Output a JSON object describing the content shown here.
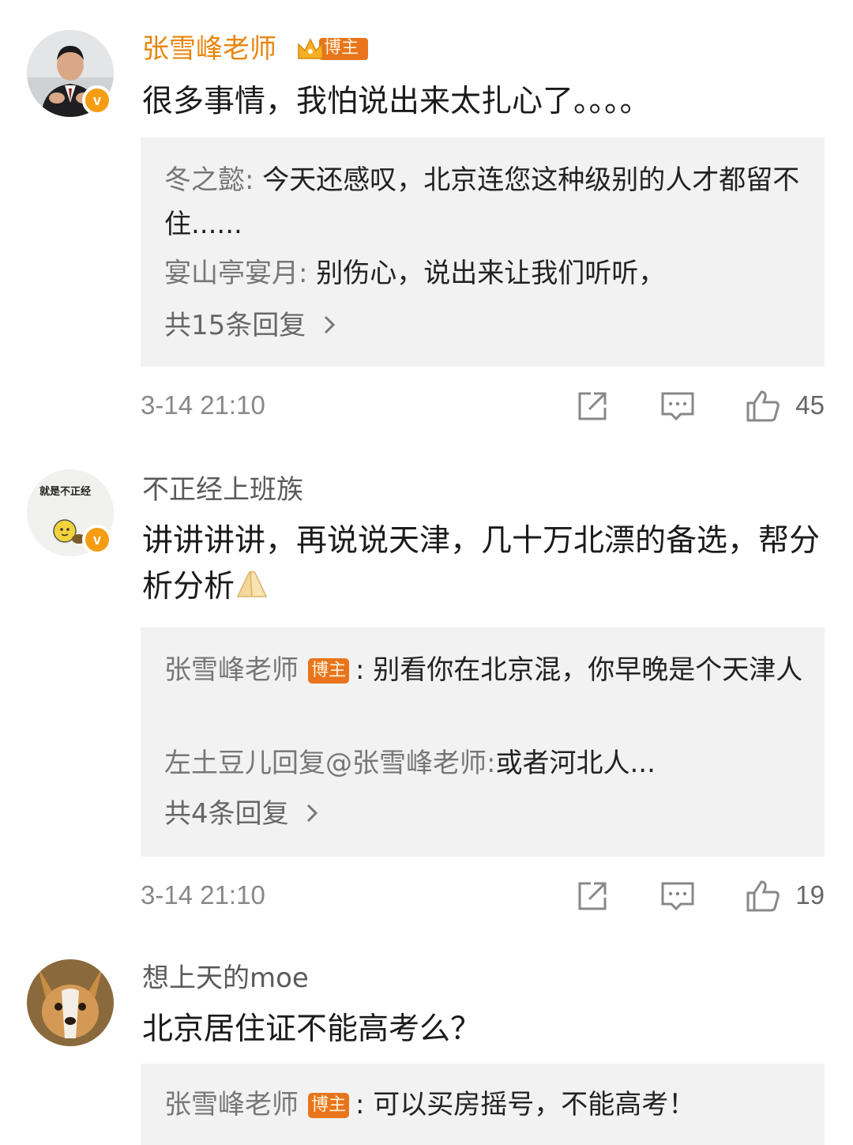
{
  "comments": [
    {
      "username": "张雪峰老师",
      "badge": "博主",
      "text": "很多事情，我怕说出来太扎心了。。。。",
      "replies": [
        {
          "name": "冬之懿",
          "sep": ": ",
          "text": "今天还感叹，北京连您这种级别的人才都留不住......"
        },
        {
          "name": "宴山亭宴月",
          "sep": ": ",
          "text": "别伤心，说出来让我们听听，"
        }
      ],
      "more_replies": "共15条回复",
      "timestamp": "3-14 21:10",
      "likes": "45"
    },
    {
      "username": "不正经上班族",
      "avatar_text": "就是不正经",
      "text": "讲讲讲讲，再说说天津，几十万北漂的备选，帮分析分析",
      "replies": [
        {
          "name": "张雪峰老师",
          "badge": "博主",
          "sep": ": ",
          "text": "别看你在北京混，你早晚是个天津人"
        },
        {
          "name": "左土豆儿回复@张雪峰老师",
          "sep": ":",
          "text": "或者河北人..."
        }
      ],
      "more_replies": "共4条回复",
      "timestamp": "3-14 21:10",
      "likes": "19"
    },
    {
      "username": "想上天的moe",
      "text": "北京居住证不能高考么？",
      "replies": [
        {
          "name": "张雪峰老师",
          "badge": "博主",
          "sep": ": ",
          "text": "可以买房摇号，不能高考！"
        }
      ]
    }
  ],
  "icons": {
    "verified": "v",
    "crown": "crown-icon",
    "share": "share-icon",
    "comment": "comment-icon",
    "like": "thumbs-up-icon",
    "chevron": "chevron-right-icon",
    "emoji": "folded-hands-emoji"
  },
  "colors": {
    "owner_name": "#e8860f",
    "badge_bg": "#e8751c",
    "verified": "#f59d12",
    "reply_bg": "#f2f2f2",
    "reply_name": "#777777",
    "meta": "#888888"
  }
}
